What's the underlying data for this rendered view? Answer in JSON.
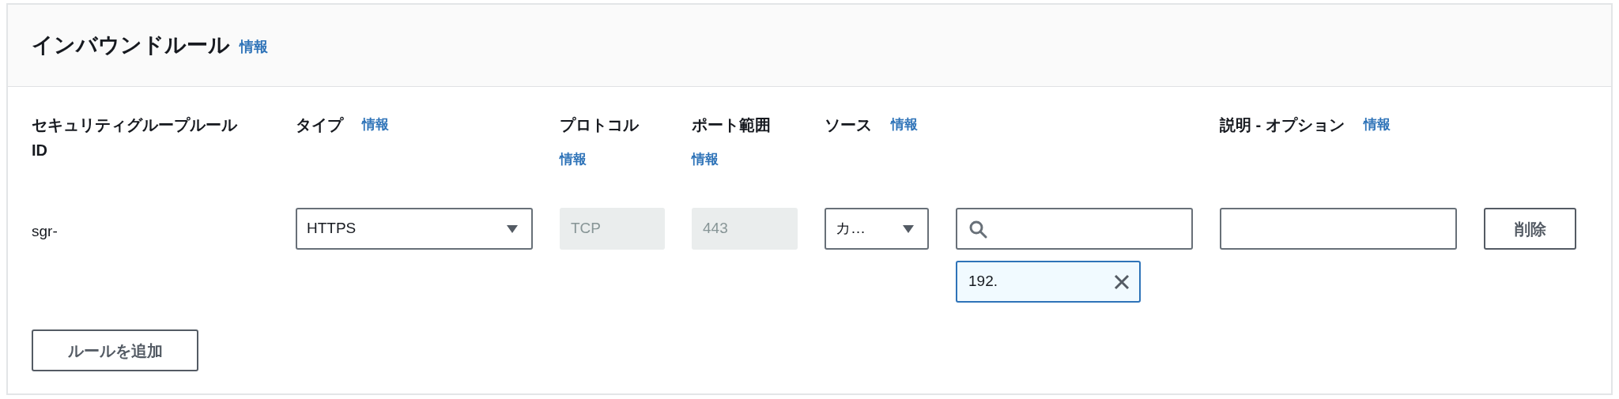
{
  "section": {
    "title": "インバウンドルール",
    "info": "情報"
  },
  "columns": [
    {
      "label": "セキュリティグループルール ID"
    },
    {
      "label": "タイプ",
      "info": "情報"
    },
    {
      "label": "プロトコル",
      "info": "情報"
    },
    {
      "label": "ポート範囲",
      "info": "情報"
    },
    {
      "label": "ソース",
      "info": "情報"
    },
    {},
    {
      "label": "説明 - オプション",
      "info": "情報"
    },
    {}
  ],
  "rows": [
    {
      "cells": [
        {
          "kind": "text",
          "value": "sgr-"
        },
        {
          "kind": "select",
          "value": "HTTPS"
        },
        {
          "kind": "readonly",
          "value": "TCP"
        },
        {
          "kind": "readonly",
          "value": "443"
        },
        {
          "kind": "select",
          "value": "カ…"
        },
        {
          "kind": "search",
          "tokens": [
            {
              "value": "192."
            }
          ]
        },
        {
          "kind": "input"
        },
        {
          "kind": "button",
          "label": "削除"
        }
      ]
    }
  ],
  "add_button": "ルールを追加"
}
